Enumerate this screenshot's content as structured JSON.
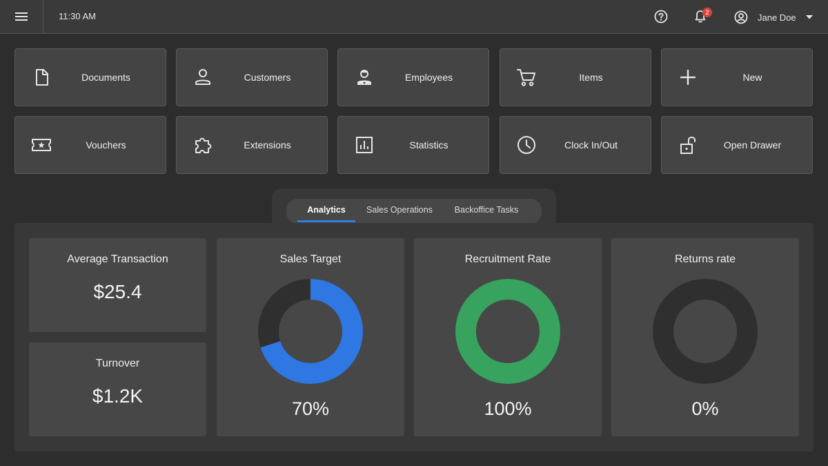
{
  "header": {
    "time": "11:30 AM",
    "notification_count": "2",
    "user_name": "Jane Doe"
  },
  "tiles": [
    {
      "label": "Documents",
      "icon": "document-icon"
    },
    {
      "label": "Customers",
      "icon": "person-icon"
    },
    {
      "label": "Employees",
      "icon": "employee-icon"
    },
    {
      "label": "Items",
      "icon": "cart-icon"
    },
    {
      "label": "New",
      "icon": "plus-icon"
    },
    {
      "label": "Vouchers",
      "icon": "voucher-icon"
    },
    {
      "label": "Extensions",
      "icon": "puzzle-icon"
    },
    {
      "label": "Statistics",
      "icon": "bar-chart-icon"
    },
    {
      "label": "Clock In/Out",
      "icon": "clock-icon"
    },
    {
      "label": "Open Drawer",
      "icon": "unlock-icon"
    }
  ],
  "tabs": [
    {
      "label": "Analytics",
      "active": true
    },
    {
      "label": "Sales Operations",
      "active": false
    },
    {
      "label": "Backoffice Tasks",
      "active": false
    }
  ],
  "analytics": {
    "average_transaction": {
      "title": "Average Transaction",
      "value": "$25.4"
    },
    "turnover": {
      "title": "Turnover",
      "value": "$1.2K"
    },
    "sales_target": {
      "title": "Sales Target",
      "percent": 70,
      "label": "70%",
      "color": "#2f77e2"
    },
    "recruitment_rate": {
      "title": "Recruitment Rate",
      "percent": 100,
      "label": "100%",
      "color": "#37a35f"
    },
    "returns_rate": {
      "title": "Returns rate",
      "percent": 0,
      "label": "0%",
      "color": "#2f77e2"
    },
    "track_color": "#2f2f2f"
  }
}
